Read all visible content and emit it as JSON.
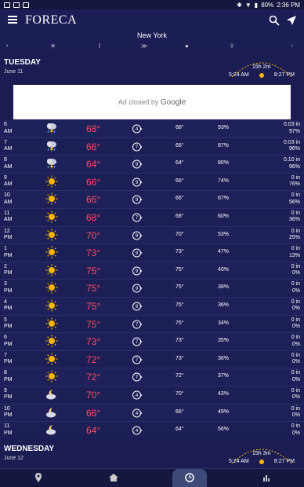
{
  "statusbar": {
    "battery": "80%",
    "time": "2:36 PM"
  },
  "app": {
    "logo": "FORECA"
  },
  "location": "New York",
  "days": [
    {
      "name": "TUESDAY",
      "date": "June 11",
      "daylight": "15h 2m",
      "sunrise": "5:24 AM",
      "sunset": "8:27 PM"
    },
    {
      "name": "WEDNESDAY",
      "date": "June 12",
      "daylight": "15h 3m",
      "sunrise": "5:24 AM",
      "sunset": "8:27 PM"
    }
  ],
  "ad": {
    "text": "Ad closed by",
    "brand": "Google"
  },
  "colors": {
    "temp": "#ff4b5c",
    "bg": "#1a1c52",
    "sun": "#f7b500"
  },
  "hours": [
    {
      "h": "6",
      "p": "AM",
      "icon": "thunderstorm",
      "t": "68°",
      "wind": "4",
      "feel": "68°",
      "hum": "93%",
      "pin": "0.03 in",
      "pp": "97%"
    },
    {
      "h": "7",
      "p": "AM",
      "icon": "thunderstorm",
      "t": "66°",
      "wind": "7",
      "feel": "66°",
      "hum": "87%",
      "pin": "0.03 in",
      "pp": "96%"
    },
    {
      "h": "8",
      "p": "AM",
      "icon": "thunderstorm",
      "t": "64°",
      "wind": "9",
      "feel": "64°",
      "hum": "80%",
      "pin": "0.10 in",
      "pp": "96%"
    },
    {
      "h": "9",
      "p": "AM",
      "icon": "sun",
      "t": "66°",
      "wind": "9",
      "feel": "66°",
      "hum": "74%",
      "pin": "0 in",
      "pp": "76%"
    },
    {
      "h": "10",
      "p": "AM",
      "icon": "sun",
      "t": "66°",
      "wind": "9",
      "feel": "66°",
      "hum": "67%",
      "pin": "0 in",
      "pp": "56%"
    },
    {
      "h": "11",
      "p": "AM",
      "icon": "sun",
      "t": "68°",
      "wind": "7",
      "feel": "68°",
      "hum": "60%",
      "pin": "0 in",
      "pp": "36%"
    },
    {
      "h": "12",
      "p": "PM",
      "icon": "sun",
      "t": "70°",
      "wind": "9",
      "feel": "70°",
      "hum": "53%",
      "pin": "0 in",
      "pp": "25%"
    },
    {
      "h": "1",
      "p": "PM",
      "icon": "sun",
      "t": "73°",
      "wind": "9",
      "feel": "73°",
      "hum": "47%",
      "pin": "0 in",
      "pp": "13%"
    },
    {
      "h": "2",
      "p": "PM",
      "icon": "sun",
      "t": "75°",
      "wind": "9",
      "feel": "75°",
      "hum": "40%",
      "pin": "0 in",
      "pp": "0%"
    },
    {
      "h": "3",
      "p": "PM",
      "icon": "sun",
      "t": "75°",
      "wind": "9",
      "feel": "75°",
      "hum": "38%",
      "pin": "0 in",
      "pp": "0%"
    },
    {
      "h": "4",
      "p": "PM",
      "icon": "sun",
      "t": "75°",
      "wind": "9",
      "feel": "75°",
      "hum": "36%",
      "pin": "0 in",
      "pp": "0%"
    },
    {
      "h": "5",
      "p": "PM",
      "icon": "sun",
      "t": "75°",
      "wind": "7",
      "feel": "75°",
      "hum": "34%",
      "pin": "0 in",
      "pp": "0%"
    },
    {
      "h": "6",
      "p": "PM",
      "icon": "sun",
      "t": "73°",
      "wind": "7",
      "feel": "73°",
      "hum": "35%",
      "pin": "0 in",
      "pp": "0%"
    },
    {
      "h": "7",
      "p": "PM",
      "icon": "sun",
      "t": "72°",
      "wind": "7",
      "feel": "73°",
      "hum": "36%",
      "pin": "0 in",
      "pp": "0%"
    },
    {
      "h": "8",
      "p": "PM",
      "icon": "sun",
      "t": "72°",
      "wind": "7",
      "feel": "72°",
      "hum": "37%",
      "pin": "0 in",
      "pp": "0%"
    },
    {
      "h": "9",
      "p": "PM",
      "icon": "moon-cloud",
      "t": "70°",
      "wind": "4",
      "feel": "70°",
      "hum": "43%",
      "pin": "0 in",
      "pp": "0%"
    },
    {
      "h": "10",
      "p": "PM",
      "icon": "moon-cloud",
      "t": "66°",
      "wind": "4",
      "feel": "66°",
      "hum": "49%",
      "pin": "0 in",
      "pp": "0%"
    },
    {
      "h": "11",
      "p": "PM",
      "icon": "moon-cloud",
      "t": "64°",
      "wind": "4",
      "feel": "64°",
      "hum": "56%",
      "pin": "0 in",
      "pp": "0%"
    }
  ]
}
